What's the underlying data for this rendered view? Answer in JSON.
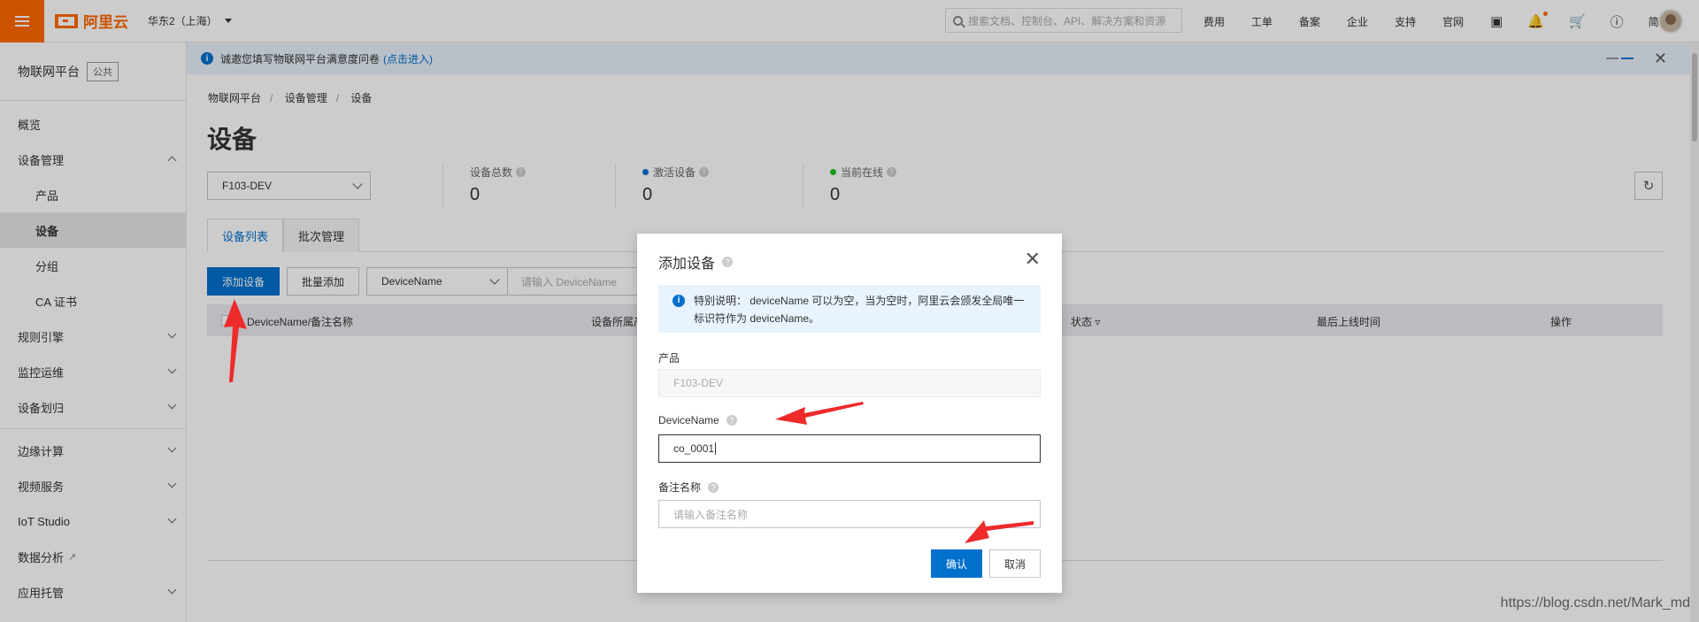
{
  "topbar": {
    "logo_text": "阿里云",
    "region": "华东2（上海）",
    "search_placeholder": "搜索文档、控制台、API、解决方案和资源",
    "links": [
      "费用",
      "工单",
      "备案",
      "企业",
      "支持",
      "官网"
    ],
    "lang": "简体"
  },
  "sidebar": {
    "title": "物联网平台",
    "tag": "公共",
    "items": [
      {
        "label": "概览"
      },
      {
        "label": "设备管理"
      },
      {
        "label": "产品"
      },
      {
        "label": "设备"
      },
      {
        "label": "分组"
      },
      {
        "label": "CA 证书"
      },
      {
        "label": "规则引擎"
      },
      {
        "label": "监控运维"
      },
      {
        "label": "设备划归"
      },
      {
        "label": "边缘计算"
      },
      {
        "label": "视频服务"
      },
      {
        "label": "IoT Studio"
      },
      {
        "label": "数据分析"
      },
      {
        "label": "应用托管"
      }
    ]
  },
  "notice": {
    "text": "诚邀您填写物联网平台满意度问卷",
    "link": "(点击进入)"
  },
  "breadcrumb": [
    "物联网平台",
    "设备管理",
    "设备"
  ],
  "page_title": "设备",
  "product_select": "F103-DEV",
  "stats": [
    {
      "label": "设备总数",
      "value": "0",
      "dot": ""
    },
    {
      "label": "激活设备",
      "value": "0",
      "dot": "#0070cc"
    },
    {
      "label": "当前在线",
      "value": "0",
      "dot": "#1dc11d"
    }
  ],
  "tabs": [
    "设备列表",
    "批次管理"
  ],
  "toolbar": {
    "add_label": "添加设备",
    "batch_label": "批量添加",
    "filter_field": "DeviceName",
    "filter_placeholder": "请输入 DeviceName"
  },
  "table": {
    "columns": [
      "DeviceName/备注名称",
      "设备所属产",
      "状态",
      "最后上线时间",
      "操作"
    ]
  },
  "dialog": {
    "title": "添加设备",
    "tip": "特别说明：  deviceName 可以为空，当为空时，阿里云会颁发全局唯一标识符作为 deviceName。",
    "product_label": "产品",
    "product_value": "F103-DEV",
    "devicename_label": "DeviceName",
    "devicename_value": "co_0001",
    "nickname_label": "备注名称",
    "nickname_placeholder": "请输入备注名称",
    "ok_label": "确认",
    "cancel_label": "取消"
  },
  "watermark": "https://blog.csdn.net/Mark_md"
}
